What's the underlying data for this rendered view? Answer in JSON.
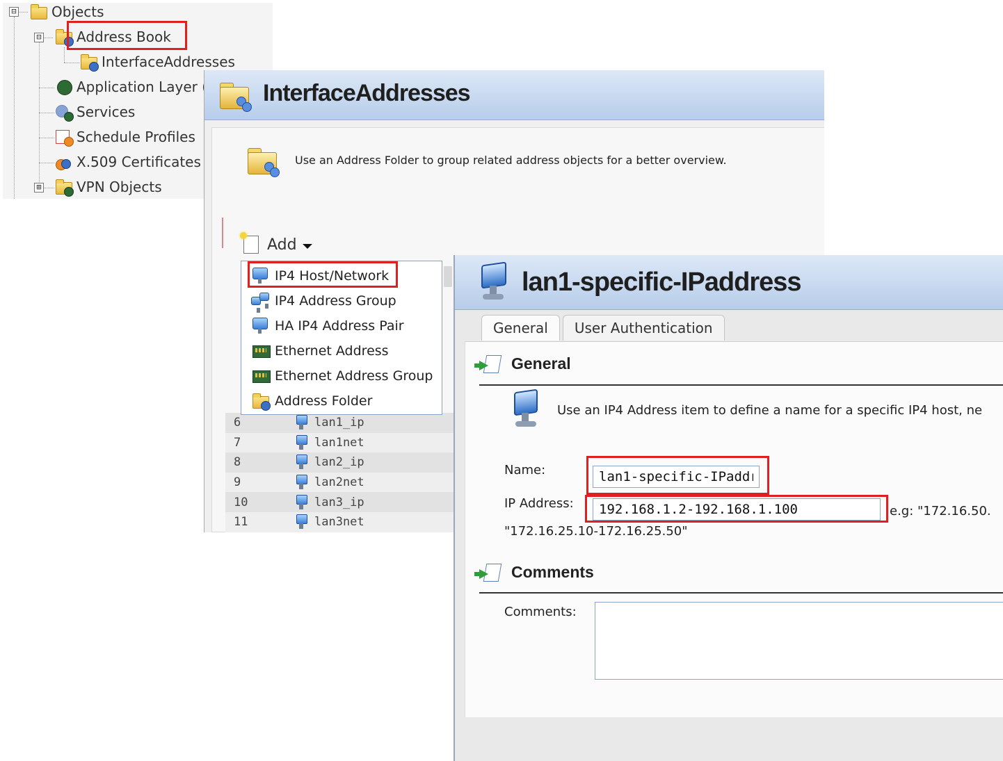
{
  "tree": {
    "items": [
      {
        "label": "Objects",
        "icon": "folder-icon"
      },
      {
        "label": "Address Book",
        "icon": "address-book-folder-icon"
      },
      {
        "label": "InterfaceAddresses",
        "icon": "address-folder-icon"
      },
      {
        "label": "Application Layer (",
        "icon": "application-layer-icon"
      },
      {
        "label": "Services",
        "icon": "services-icon"
      },
      {
        "label": "Schedule Profiles",
        "icon": "schedule-icon"
      },
      {
        "label": "X.509 Certificates",
        "icon": "certificate-icon"
      },
      {
        "label": "VPN Objects",
        "icon": "folder-icon"
      }
    ],
    "expanders": [
      "⊟",
      "⊟",
      "⊞"
    ]
  },
  "interface_addresses": {
    "title": "InterfaceAddresses",
    "description": "Use an Address Folder to group related address objects for a better overview.",
    "add_label": "Add",
    "menu": [
      {
        "label": "IP4 Host/Network",
        "icon": "host-network-icon"
      },
      {
        "label": "IP4 Address Group",
        "icon": "address-group-icon"
      },
      {
        "label": "HA IP4 Address Pair",
        "icon": "ha-pair-icon"
      },
      {
        "label": "Ethernet Address",
        "icon": "ethernet-icon"
      },
      {
        "label": "Ethernet Address Group",
        "icon": "ethernet-group-icon"
      },
      {
        "label": "Address Folder",
        "icon": "address-folder-icon"
      }
    ],
    "rows": [
      {
        "num": "6",
        "name": "lan1_ip"
      },
      {
        "num": "7",
        "name": "lan1net"
      },
      {
        "num": "8",
        "name": "lan2_ip"
      },
      {
        "num": "9",
        "name": "lan2net"
      },
      {
        "num": "10",
        "name": "lan3_ip"
      },
      {
        "num": "11",
        "name": "lan3net"
      }
    ]
  },
  "ip_object": {
    "title": "lan1-specific-IPaddress",
    "tabs": [
      "General",
      "User Authentication"
    ],
    "general_header": "General",
    "description": "Use an IP4 Address item to define a name for a specific IP4 host, ne",
    "name_label": "Name:",
    "name_value": "lan1-specific-IPaddress",
    "ip_label": "IP Address:",
    "ip_value": "192.168.1.2-192.168.1.100",
    "ip_example": "e.g: \"172.16.50.",
    "ip_example_line2": "\"172.16.25.10-172.16.25.50\"",
    "comments_header": "Comments",
    "comments_label": "Comments:",
    "comments_value": ""
  },
  "colors": {
    "highlight": "#e02020",
    "header_blue": "#b7cdea"
  }
}
